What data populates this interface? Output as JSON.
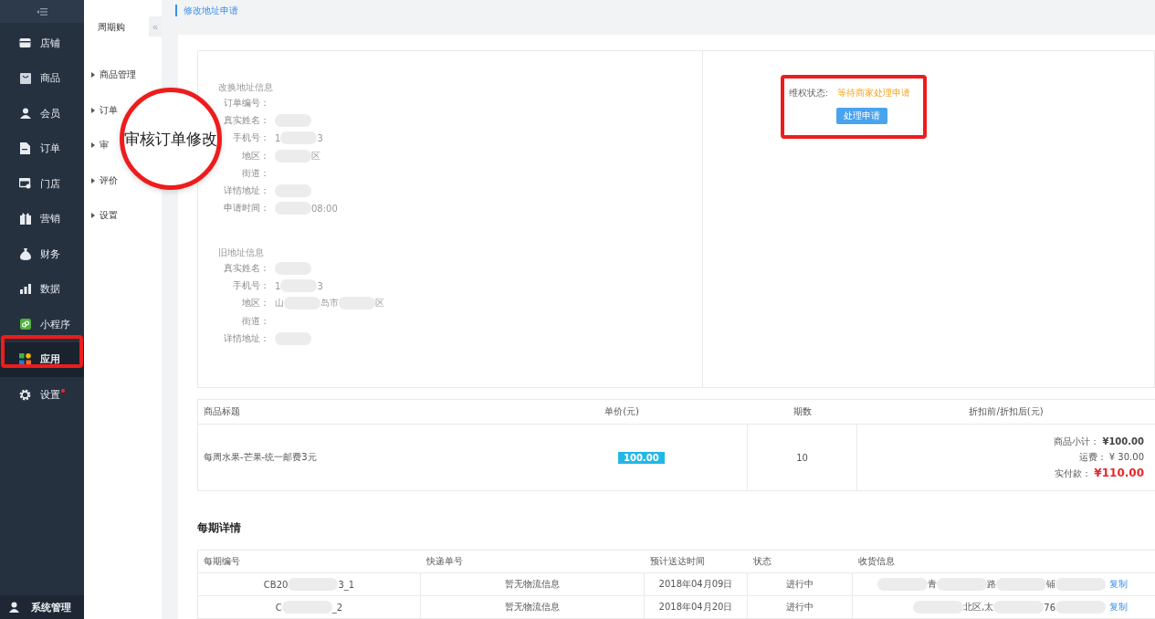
{
  "sidebar": {
    "items": [
      {
        "label": "店铺",
        "kind": "store",
        "selected": false,
        "badge": false
      },
      {
        "label": "商品",
        "kind": "goods",
        "selected": false,
        "badge": false
      },
      {
        "label": "会员",
        "kind": "member",
        "selected": false,
        "badge": false
      },
      {
        "label": "订单",
        "kind": "order",
        "selected": false,
        "badge": false
      },
      {
        "label": "门店",
        "kind": "shop",
        "selected": false,
        "badge": false
      },
      {
        "label": "营销",
        "kind": "gift",
        "selected": false,
        "badge": false
      },
      {
        "label": "财务",
        "kind": "money",
        "selected": false,
        "badge": false
      },
      {
        "label": "数据",
        "kind": "chart",
        "selected": false,
        "badge": false
      },
      {
        "label": "小程序",
        "kind": "miniapp",
        "selected": false,
        "badge": false
      },
      {
        "label": "应用",
        "kind": "apps",
        "selected": true,
        "badge": false
      },
      {
        "label": "设置",
        "kind": "gear",
        "selected": false,
        "badge": true
      }
    ],
    "footer": "系统管理"
  },
  "subnav": {
    "title": "周期购",
    "collapse": "«",
    "items": [
      "商品管理",
      "订单",
      "审",
      "评价",
      "设置"
    ]
  },
  "breadcrumb": "修改地址申请",
  "new_address": {
    "title": "改换地址信息",
    "fields": [
      {
        "label": "订单编号："
      },
      {
        "label": "真实姓名：",
        "value": [
          {
            "kind": "blur"
          }
        ]
      },
      {
        "label": "手机号：",
        "value": [
          {
            "kind": "text",
            "text": "1"
          },
          {
            "kind": "blur"
          },
          {
            "kind": "text",
            "text": "3"
          }
        ]
      },
      {
        "label": "地区：",
        "value": [
          {
            "kind": "blur"
          },
          {
            "kind": "text",
            "text": "区"
          }
        ]
      },
      {
        "label": "街道："
      },
      {
        "label": "详情地址：",
        "value": [
          {
            "kind": "blur"
          }
        ]
      },
      {
        "label": "申请时间：",
        "value": [
          {
            "kind": "blur"
          },
          {
            "kind": "text",
            "text": "08:00"
          }
        ]
      }
    ]
  },
  "old_address": {
    "title": "旧地址信息",
    "fields": [
      {
        "label": "真实姓名：",
        "value": [
          {
            "kind": "blur"
          }
        ]
      },
      {
        "label": "手机号：",
        "value": [
          {
            "kind": "text",
            "text": "1"
          },
          {
            "kind": "blur"
          },
          {
            "kind": "text",
            "text": "3"
          }
        ]
      },
      {
        "label": "地区：",
        "value": [
          {
            "kind": "text",
            "text": "山"
          },
          {
            "kind": "blur"
          },
          {
            "kind": "text",
            "text": "岛市"
          },
          {
            "kind": "blur"
          },
          {
            "kind": "text",
            "text": "区"
          }
        ]
      },
      {
        "label": "街道："
      },
      {
        "label": "详情地址：",
        "value": [
          {
            "kind": "blur"
          }
        ]
      }
    ]
  },
  "status": {
    "label": "维权状态:",
    "value": "等待商家处理申请",
    "button": "处理申请"
  },
  "product_table": {
    "columns": [
      "商品标题",
      "单价(元)",
      "期数",
      "折扣前/折扣后(元)"
    ],
    "rows": [
      {
        "title": "每周水果-芒果-统一邮费3元",
        "price": "100.00",
        "periods": "10",
        "subtotal_label": "商品小计：",
        "subtotal": "¥100.00",
        "shipping_label": "运费：",
        "shipping": "¥ 30.00",
        "paid_label": "实付款：",
        "paid": "¥110.00"
      }
    ]
  },
  "period_details": {
    "title": "每期详情",
    "columns": [
      "每期编号",
      "快递单号",
      "预计送达时间",
      "状态",
      "收货信息"
    ],
    "rows": [
      {
        "number": [
          {
            "kind": "text",
            "text": "CB20"
          },
          {
            "kind": "blur"
          },
          {
            "kind": "text",
            "text": "3_1"
          }
        ],
        "tracking": "暂无物流信息",
        "date": "2018年04月09日",
        "state": "进行中",
        "address": [
          {
            "kind": "blur"
          },
          {
            "kind": "text",
            "text": "青"
          },
          {
            "kind": "blur"
          },
          {
            "kind": "text",
            "text": "路"
          },
          {
            "kind": "blur"
          },
          {
            "kind": "text",
            "text": "铺"
          },
          {
            "kind": "blur"
          }
        ],
        "copy": "复制"
      },
      {
        "number": [
          {
            "kind": "text",
            "text": "C"
          },
          {
            "kind": "blur"
          },
          {
            "kind": "text",
            "text": "_2"
          }
        ],
        "tracking": "暂无物流信息",
        "date": "2018年04月20日",
        "state": "进行中",
        "address": [
          {
            "kind": "blur"
          },
          {
            "kind": "text",
            "text": "北区,太"
          },
          {
            "kind": "blur"
          },
          {
            "kind": "text",
            "text": "76"
          },
          {
            "kind": "blur"
          }
        ],
        "copy": "复制"
      }
    ]
  },
  "annotations": [
    {
      "kind": "magnifier",
      "text": "审核订单修改"
    },
    {
      "kind": "frame-nav"
    },
    {
      "kind": "frame-status"
    }
  ]
}
